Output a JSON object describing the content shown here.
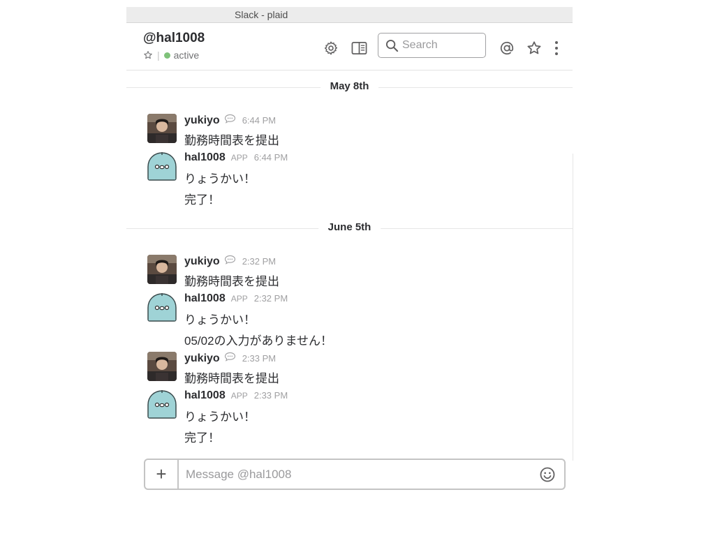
{
  "window": {
    "title": "Slack - plaid"
  },
  "header": {
    "channel_name": "@hal1008",
    "status": "active",
    "search_placeholder": "Search"
  },
  "icons": {
    "star_small": "star-outline-icon",
    "settings": "gear-icon",
    "sidebar": "sidebar-toggle-icon",
    "search": "search-icon",
    "mentions": "at-sign-icon",
    "starred": "star-outline-icon",
    "more": "vertical-ellipsis-icon",
    "attach": "plus-icon",
    "emoji": "smiley-icon",
    "bubble": "speech-bubble-icon"
  },
  "colors": {
    "active_dot": "#7fc27a",
    "bot_avatar": "#9fd3d6"
  },
  "feed": {
    "days": [
      {
        "label": "May 8th",
        "messages": [
          {
            "author": "yukiyo",
            "time": "6:44 PM",
            "lines": [
              "勤務時間表を提出"
            ]
          },
          {
            "author": "hal1008",
            "badge": "APP",
            "time": "6:44 PM",
            "lines": [
              "りょうかい！",
              "完了！"
            ]
          }
        ]
      },
      {
        "label": "June 5th",
        "messages": [
          {
            "author": "yukiyo",
            "time": "2:32 PM",
            "lines": [
              "勤務時間表を提出"
            ]
          },
          {
            "author": "hal1008",
            "badge": "APP",
            "time": "2:32 PM",
            "lines": [
              "りょうかい！",
              "05/02の入力がありません！"
            ]
          },
          {
            "author": "yukiyo",
            "time": "2:33 PM",
            "lines": [
              "勤務時間表を提出"
            ]
          },
          {
            "author": "hal1008",
            "badge": "APP",
            "time": "2:33 PM",
            "lines": [
              "りょうかい！",
              "完了！"
            ]
          }
        ]
      }
    ]
  },
  "composer": {
    "plus": "+",
    "placeholder": "Message @hal1008"
  }
}
